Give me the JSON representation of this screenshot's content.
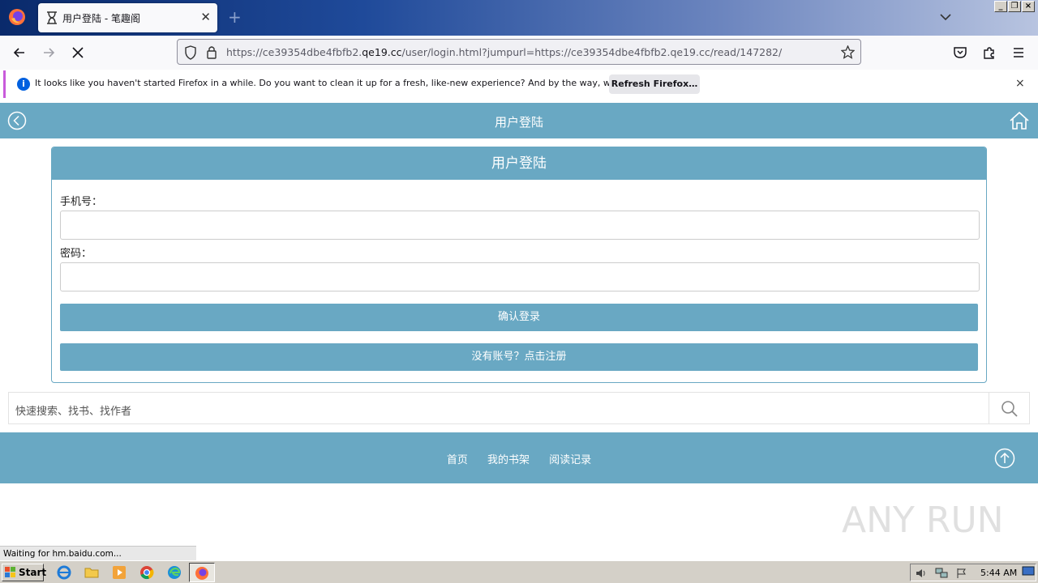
{
  "browser": {
    "tab_title": "用户登陆 - 笔趣阁",
    "url_prefix": "https://ce39354dbe4fbfb2.",
    "url_domain": "qe19.cc",
    "url_suffix": "/user/login.html?jumpurl=https://ce39354dbe4fbfb2.qe19.cc/read/147282/",
    "window_buttons": [
      "_",
      "❐",
      "×"
    ]
  },
  "notification": {
    "text": "It looks like you haven't started Firefox in a while. Do you want to clean it up for a fresh, like-new experience? And by the way, welcome back!",
    "button_label": "Refresh Firefox…",
    "close": "×"
  },
  "page": {
    "header_title": "用户登陆",
    "login": {
      "box_title": "用户登陆",
      "phone_label": "手机号：",
      "phone_value": "",
      "password_label": "密码：",
      "password_value": "",
      "submit_label": "确认登录",
      "register_label": "没有账号？点击注册"
    },
    "search": {
      "placeholder": "快速搜索、找书、找作者"
    },
    "footer": {
      "links": [
        "首页",
        "我的书架",
        "阅读记录"
      ]
    }
  },
  "status_bar": {
    "text": "Waiting for hm.baidu.com..."
  },
  "taskbar": {
    "start_label": "Start",
    "clock": "5:44 AM"
  },
  "watermark": "ANY RUN",
  "colors": {
    "accent": "#69a8c3",
    "notice_border": "#c95bdb"
  }
}
